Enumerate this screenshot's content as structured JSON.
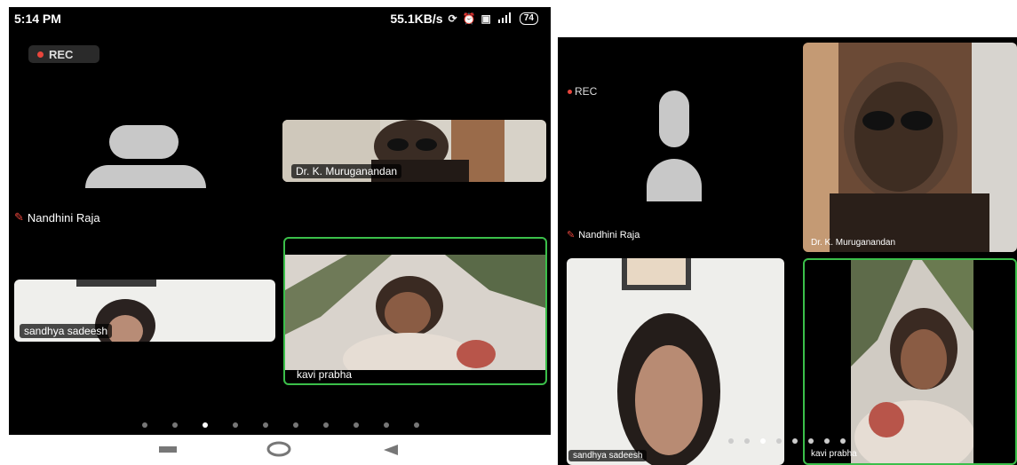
{
  "left": {
    "status": {
      "time": "5:14 PM",
      "speed": "55.1KB/s",
      "signal": "4G",
      "battery": "74",
      "icons": [
        "sync-icon",
        "alarm-icon",
        "volte-icon",
        "signal-icon",
        "battery-icon"
      ]
    },
    "rec_label": "REC",
    "participants": {
      "nandhini": "Nandhini Raja",
      "muruganandan": "Dr. K. Muruganandan",
      "sandhya": "sandhya sadeesh",
      "kavi": "kavi prabha"
    },
    "page_dots": 10,
    "active_dot": 2,
    "nav": [
      "recents-button",
      "home-button",
      "back-button"
    ]
  },
  "right": {
    "rec_label": "REC",
    "participants": {
      "nandhini": "Nandhini Raja",
      "muruganandan": "Dr. K. Muruganandan",
      "sandhya": "sandhya sadeesh",
      "kavi": "kavi prabha"
    },
    "page_dots": 8,
    "active_dot": 2
  },
  "colors": {
    "active_border": "#3bbf4a",
    "rec_dot": "#e8453c",
    "avatar": "#c8c8c8",
    "background": "#000000"
  }
}
